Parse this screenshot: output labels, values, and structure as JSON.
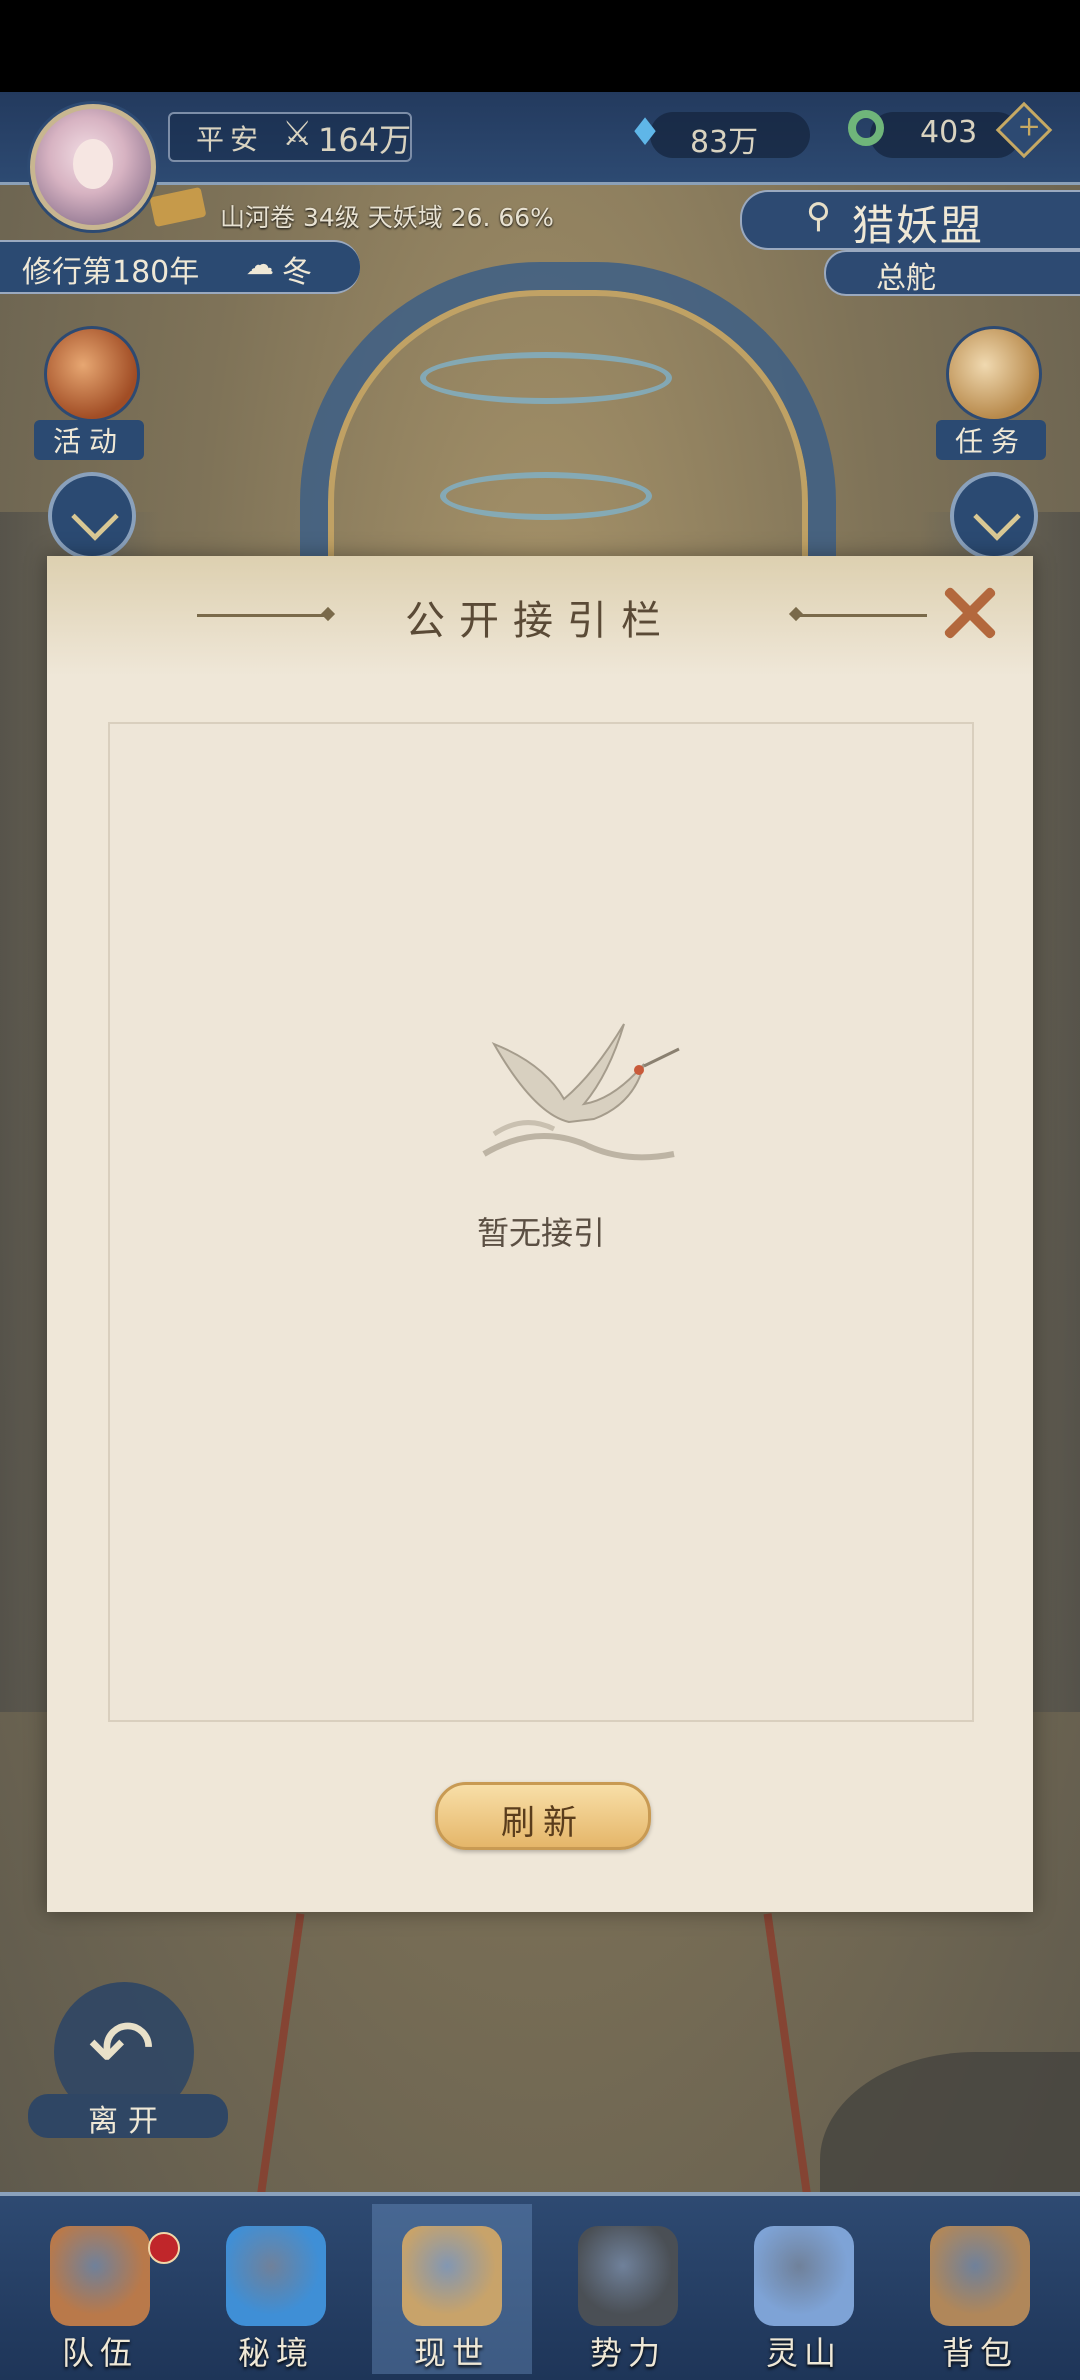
{
  "hud": {
    "status": "平安",
    "power": "164万",
    "crystal": "83万",
    "jade": "403",
    "level_info": "山河卷 34级 天妖域 26. 66%",
    "year": "修行第180年",
    "season": "冬",
    "guild_name": "猎妖盟",
    "guild_sub": "总舵"
  },
  "side": {
    "left_label": "活动",
    "right_label": "任务"
  },
  "modal": {
    "title": "公开接引栏",
    "empty_text": "暂无接引",
    "refresh_label": "刷新"
  },
  "leave_label": "离开",
  "bottom_nav": [
    {
      "label": "队伍",
      "icon": "team-icon",
      "color": "#b9794a"
    },
    {
      "label": "秘境",
      "icon": "portal-icon",
      "color": "#3f8fd6"
    },
    {
      "label": "现世",
      "icon": "world-scroll-icon",
      "color": "#c8a36a"
    },
    {
      "label": "势力",
      "icon": "faction-building-icon",
      "color": "#4a4f55"
    },
    {
      "label": "灵山",
      "icon": "mountain-icon",
      "color": "#7ea3d6"
    },
    {
      "label": "背包",
      "icon": "backpack-icon",
      "color": "#b0875a"
    }
  ],
  "colors": {
    "accent_blue": "#2d4a72",
    "gold": "#c89a53",
    "modal_bg": "#efe7d8"
  }
}
